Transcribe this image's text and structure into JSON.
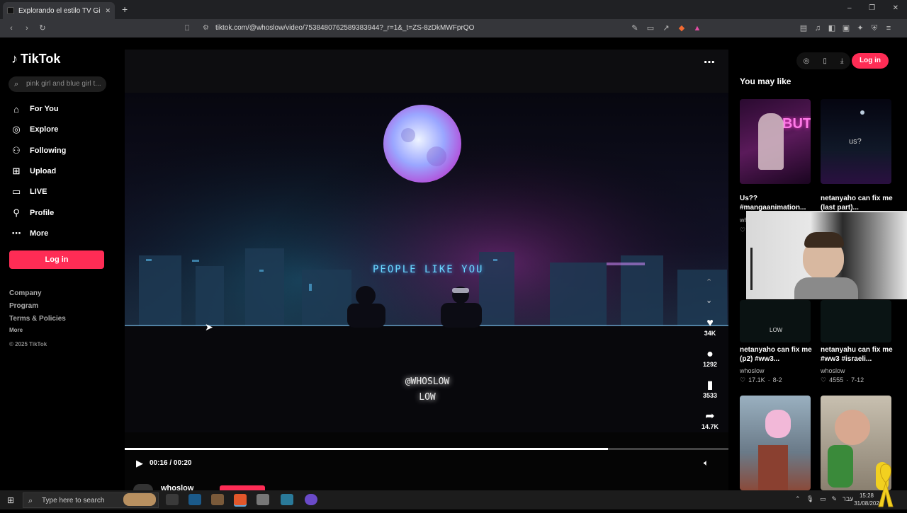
{
  "browser": {
    "tab_title": "Explorando el estilo TV Girl | Tik",
    "new_tab": "+",
    "close_tab": "✕",
    "url": "tiktok.com/@whoslow/video/7538480762589383944?_r=1&_t=ZS-8zDkMWFprQO",
    "window_controls": [
      "–",
      "❐",
      "✕"
    ]
  },
  "sidebar": {
    "logo": "TikTok",
    "search_placeholder": "pink girl and blue girl t...",
    "nav": [
      {
        "label": "For You",
        "icon": "home-icon"
      },
      {
        "label": "Explore",
        "icon": "compass-icon"
      },
      {
        "label": "Following",
        "icon": "person-icon"
      },
      {
        "label": "Upload",
        "icon": "plus-square-icon"
      },
      {
        "label": "LIVE",
        "icon": "tv-icon"
      },
      {
        "label": "Profile",
        "icon": "profile-icon"
      },
      {
        "label": "More",
        "icon": "more-icon"
      }
    ],
    "login": "Log in",
    "footer": {
      "company": "Company",
      "program": "Program",
      "terms": "Terms & Policies",
      "more": "More",
      "copyright": "© 2025 TikTok"
    }
  },
  "video": {
    "overlay_title": "PEOPLE LIKE YOU",
    "watermark_line1": "@WHOSLOW",
    "watermark_line2": "LOW",
    "time": "00:16 / 00:20",
    "progress": 0.8,
    "author": "whoslow",
    "actions": {
      "likes": "34K",
      "comments": "1292",
      "saves": "3533",
      "shares": "14.7K"
    }
  },
  "right": {
    "login": "Log in",
    "heading": "You may like",
    "items": [
      {
        "caption": "Us?? #mangaanimation...",
        "author": "wh",
        "thumb_text": "BUT TH"
      },
      {
        "caption": "netanyaho can fix me (last part)...",
        "author": "",
        "thumb_text": "us?"
      },
      {
        "caption": "netanyaho can fix me (p2) #ww3...",
        "author": "whoslow",
        "likes": "17.1K",
        "date": "8-2"
      },
      {
        "caption": "netanyahu can fix me #ww3 #israeli...",
        "author": "whoslow",
        "likes": "4555",
        "date": "7-12"
      }
    ]
  },
  "taskbar": {
    "search_placeholder": "Type here to search",
    "time": "15:28",
    "date": "31/08/202",
    "lang": "עבר"
  }
}
